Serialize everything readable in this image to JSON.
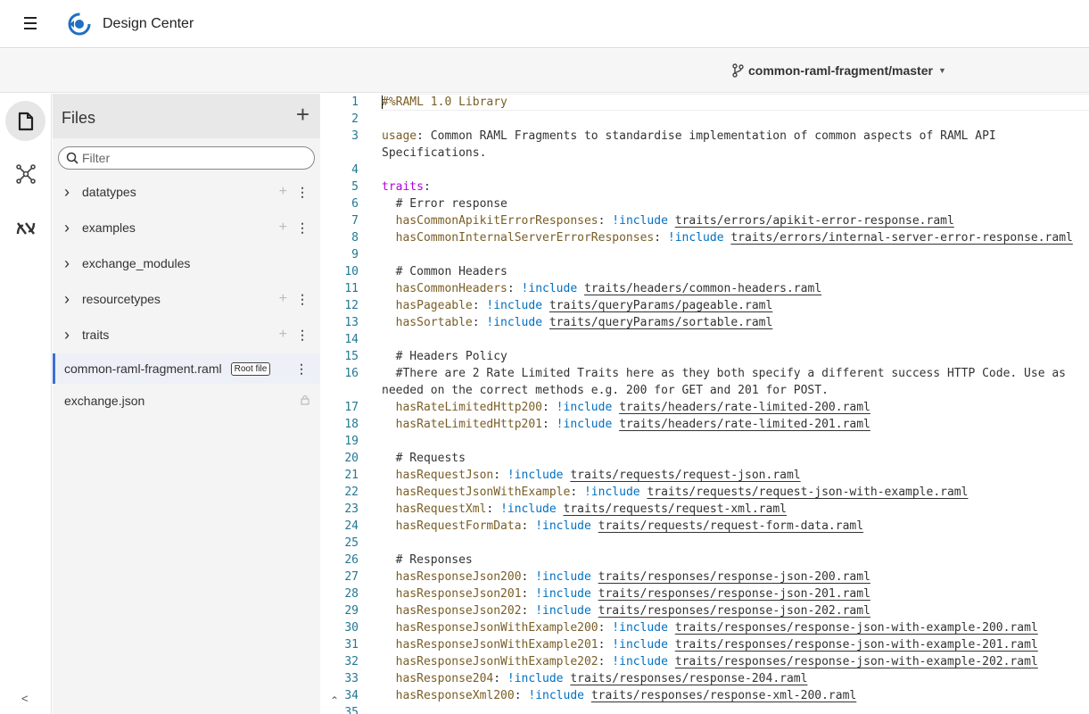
{
  "app": {
    "title": "Design Center"
  },
  "branch": {
    "label": "common-raml-fragment/master"
  },
  "files_panel": {
    "title": "Files",
    "filter_placeholder": "Filter",
    "folders": [
      {
        "label": "datatypes",
        "has_actions": true
      },
      {
        "label": "examples",
        "has_actions": true
      },
      {
        "label": "exchange_modules",
        "has_actions": false
      },
      {
        "label": "resourcetypes",
        "has_actions": true
      },
      {
        "label": "traits",
        "has_actions": true
      }
    ],
    "files": [
      {
        "label": "common-raml-fragment.raml",
        "badge": "Root file",
        "active": true
      },
      {
        "label": "exchange.json",
        "locked": true
      }
    ]
  },
  "rail": {
    "collapse_label": "<"
  },
  "editor": {
    "lines": [
      {
        "n": "1",
        "parts": [
          [
            "c-yellow",
            "#%RAML 1.0 Library"
          ]
        ]
      },
      {
        "n": "2",
        "parts": []
      },
      {
        "n": "3",
        "parts": [
          [
            "c-key",
            "usage"
          ],
          [
            "c-com",
            ": Common RAML Fragments to standardise implementation of common aspects of RAML API"
          ]
        ]
      },
      {
        "n": "",
        "parts": [
          [
            "c-com",
            "Specifications."
          ]
        ]
      },
      {
        "n": "4",
        "parts": []
      },
      {
        "n": "5",
        "parts": [
          [
            "c-pink",
            "traits"
          ],
          [
            "c-com",
            ":"
          ]
        ]
      },
      {
        "n": "6",
        "parts": [
          [
            "c-com",
            "  # Error response"
          ]
        ]
      },
      {
        "n": "7",
        "parts": [
          [
            "c-key",
            "  hasCommonApikitErrorResponses"
          ],
          [
            "c-com",
            ": "
          ],
          [
            "c-inc",
            "!include"
          ],
          [
            "c-com",
            " "
          ],
          [
            "c-path",
            "traits/errors/apikit-error-response.raml"
          ]
        ]
      },
      {
        "n": "8",
        "parts": [
          [
            "c-key",
            "  hasCommonInternalServerErrorResponses"
          ],
          [
            "c-com",
            ": "
          ],
          [
            "c-inc",
            "!include"
          ],
          [
            "c-com",
            " "
          ],
          [
            "c-path",
            "traits/errors/internal-server-error-response.raml"
          ]
        ]
      },
      {
        "n": "9",
        "parts": []
      },
      {
        "n": "10",
        "parts": [
          [
            "c-com",
            "  # Common Headers"
          ]
        ]
      },
      {
        "n": "11",
        "parts": [
          [
            "c-key",
            "  hasCommonHeaders"
          ],
          [
            "c-com",
            ": "
          ],
          [
            "c-inc",
            "!include"
          ],
          [
            "c-com",
            " "
          ],
          [
            "c-path",
            "traits/headers/common-headers.raml"
          ]
        ]
      },
      {
        "n": "12",
        "parts": [
          [
            "c-key",
            "  hasPageable"
          ],
          [
            "c-com",
            ": "
          ],
          [
            "c-inc",
            "!include"
          ],
          [
            "c-com",
            " "
          ],
          [
            "c-path",
            "traits/queryParams/pageable.raml"
          ]
        ]
      },
      {
        "n": "13",
        "parts": [
          [
            "c-key",
            "  hasSortable"
          ],
          [
            "c-com",
            ": "
          ],
          [
            "c-inc",
            "!include"
          ],
          [
            "c-com",
            " "
          ],
          [
            "c-path",
            "traits/queryParams/sortable.raml"
          ]
        ]
      },
      {
        "n": "14",
        "parts": []
      },
      {
        "n": "15",
        "parts": [
          [
            "c-com",
            "  # Headers Policy"
          ]
        ]
      },
      {
        "n": "16",
        "parts": [
          [
            "c-com",
            "  #There are 2 Rate Limited Traits here as they both specify a different success HTTP Code. Use as"
          ]
        ]
      },
      {
        "n": "",
        "parts": [
          [
            "c-com",
            "needed on the correct methods e.g. 200 for GET and 201 for POST."
          ]
        ]
      },
      {
        "n": "17",
        "parts": [
          [
            "c-key",
            "  hasRateLimitedHttp200"
          ],
          [
            "c-com",
            ": "
          ],
          [
            "c-inc",
            "!include"
          ],
          [
            "c-com",
            " "
          ],
          [
            "c-path",
            "traits/headers/rate-limited-200.raml"
          ]
        ]
      },
      {
        "n": "18",
        "parts": [
          [
            "c-key",
            "  hasRateLimitedHttp201"
          ],
          [
            "c-com",
            ": "
          ],
          [
            "c-inc",
            "!include"
          ],
          [
            "c-com",
            " "
          ],
          [
            "c-path",
            "traits/headers/rate-limited-201.raml"
          ]
        ]
      },
      {
        "n": "19",
        "parts": []
      },
      {
        "n": "20",
        "parts": [
          [
            "c-com",
            "  # Requests"
          ]
        ]
      },
      {
        "n": "21",
        "parts": [
          [
            "c-key",
            "  hasRequestJson"
          ],
          [
            "c-com",
            ": "
          ],
          [
            "c-inc",
            "!include"
          ],
          [
            "c-com",
            " "
          ],
          [
            "c-path",
            "traits/requests/request-json.raml"
          ]
        ]
      },
      {
        "n": "22",
        "parts": [
          [
            "c-key",
            "  hasRequestJsonWithExample"
          ],
          [
            "c-com",
            ": "
          ],
          [
            "c-inc",
            "!include"
          ],
          [
            "c-com",
            " "
          ],
          [
            "c-path",
            "traits/requests/request-json-with-example.raml"
          ]
        ]
      },
      {
        "n": "23",
        "parts": [
          [
            "c-key",
            "  hasRequestXml"
          ],
          [
            "c-com",
            ": "
          ],
          [
            "c-inc",
            "!include"
          ],
          [
            "c-com",
            " "
          ],
          [
            "c-path",
            "traits/requests/request-xml.raml"
          ]
        ]
      },
      {
        "n": "24",
        "parts": [
          [
            "c-key",
            "  hasRequestFormData"
          ],
          [
            "c-com",
            ": "
          ],
          [
            "c-inc",
            "!include"
          ],
          [
            "c-com",
            " "
          ],
          [
            "c-path",
            "traits/requests/request-form-data.raml"
          ]
        ]
      },
      {
        "n": "25",
        "parts": []
      },
      {
        "n": "26",
        "parts": [
          [
            "c-com",
            "  # Responses"
          ]
        ]
      },
      {
        "n": "27",
        "parts": [
          [
            "c-key",
            "  hasResponseJson200"
          ],
          [
            "c-com",
            ": "
          ],
          [
            "c-inc",
            "!include"
          ],
          [
            "c-com",
            " "
          ],
          [
            "c-path",
            "traits/responses/response-json-200.raml"
          ]
        ]
      },
      {
        "n": "28",
        "parts": [
          [
            "c-key",
            "  hasResponseJson201"
          ],
          [
            "c-com",
            ": "
          ],
          [
            "c-inc",
            "!include"
          ],
          [
            "c-com",
            " "
          ],
          [
            "c-path",
            "traits/responses/response-json-201.raml"
          ]
        ]
      },
      {
        "n": "29",
        "parts": [
          [
            "c-key",
            "  hasResponseJson202"
          ],
          [
            "c-com",
            ": "
          ],
          [
            "c-inc",
            "!include"
          ],
          [
            "c-com",
            " "
          ],
          [
            "c-path",
            "traits/responses/response-json-202.raml"
          ]
        ]
      },
      {
        "n": "30",
        "parts": [
          [
            "c-key",
            "  hasResponseJsonWithExample200"
          ],
          [
            "c-com",
            ": "
          ],
          [
            "c-inc",
            "!include"
          ],
          [
            "c-com",
            " "
          ],
          [
            "c-path",
            "traits/responses/response-json-with-example-200.raml"
          ]
        ]
      },
      {
        "n": "31",
        "parts": [
          [
            "c-key",
            "  hasResponseJsonWithExample201"
          ],
          [
            "c-com",
            ": "
          ],
          [
            "c-inc",
            "!include"
          ],
          [
            "c-com",
            " "
          ],
          [
            "c-path",
            "traits/responses/response-json-with-example-201.raml"
          ]
        ]
      },
      {
        "n": "32",
        "parts": [
          [
            "c-key",
            "  hasResponseJsonWithExample202"
          ],
          [
            "c-com",
            ": "
          ],
          [
            "c-inc",
            "!include"
          ],
          [
            "c-com",
            " "
          ],
          [
            "c-path",
            "traits/responses/response-json-with-example-202.raml"
          ]
        ]
      },
      {
        "n": "33",
        "parts": [
          [
            "c-key",
            "  hasResponse204"
          ],
          [
            "c-com",
            ": "
          ],
          [
            "c-inc",
            "!include"
          ],
          [
            "c-com",
            " "
          ],
          [
            "c-path",
            "traits/responses/response-204.raml"
          ]
        ]
      },
      {
        "n": "34",
        "parts": [
          [
            "c-key",
            "  hasResponseXml200"
          ],
          [
            "c-com",
            ": "
          ],
          [
            "c-inc",
            "!include"
          ],
          [
            "c-com",
            " "
          ],
          [
            "c-path",
            "traits/responses/response-xml-200.raml"
          ]
        ]
      },
      {
        "n": "35",
        "parts": []
      }
    ]
  }
}
